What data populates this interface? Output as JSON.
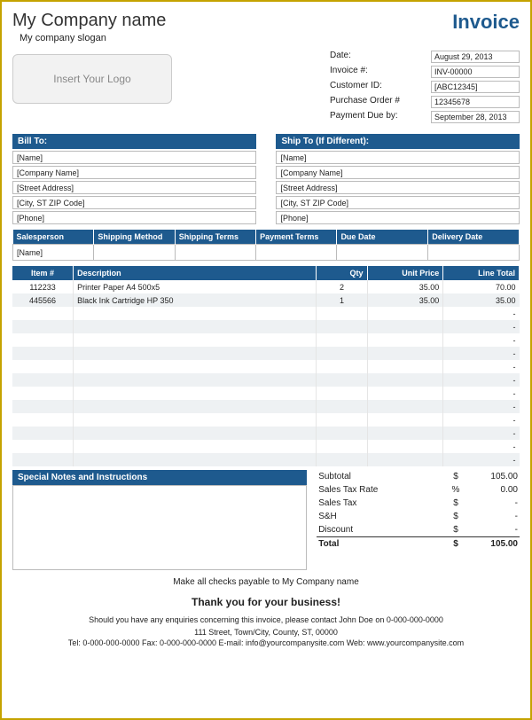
{
  "header": {
    "company_name": "My Company name",
    "slogan": "My company slogan",
    "invoice_title": "Invoice",
    "logo_placeholder": "Insert Your Logo"
  },
  "info": {
    "date_label": "Date:",
    "date_value": "August 29, 2013",
    "invoice_no_label": "Invoice #:",
    "invoice_no_value": "INV-00000",
    "customer_id_label": "Customer ID:",
    "customer_id_value": "[ABC12345]",
    "po_label": "Purchase Order #",
    "po_value": "12345678",
    "due_label": "Payment Due by:",
    "due_value": "September 28, 2013"
  },
  "bill_to": {
    "title": "Bill To:",
    "name": "[Name]",
    "company": "[Company Name]",
    "street": "[Street Address]",
    "city": "[City, ST  ZIP Code]",
    "phone": "[Phone]"
  },
  "ship_to": {
    "title": "Ship To (If Different):",
    "name": "[Name]",
    "company": "[Company Name]",
    "street": "[Street Address]",
    "city": "[City, ST  ZIP Code]",
    "phone": "[Phone]"
  },
  "terms": {
    "headers": [
      "Salesperson",
      "Shipping Method",
      "Shipping Terms",
      "Payment Terms",
      "Due Date",
      "Delivery Date"
    ],
    "values": [
      "[Name]",
      "",
      "",
      "",
      "",
      ""
    ]
  },
  "items": {
    "headers": {
      "item": "Item #",
      "desc": "Description",
      "qty": "Qty",
      "unit": "Unit Price",
      "line": "Line Total"
    },
    "rows": [
      {
        "item": "112233",
        "desc": "Printer Paper A4 500x5",
        "qty": "2",
        "unit": "35.00",
        "line": "70.00"
      },
      {
        "item": "445566",
        "desc": "Black Ink Cartridge HP 350",
        "qty": "1",
        "unit": "35.00",
        "line": "35.00"
      },
      {
        "item": "",
        "desc": "",
        "qty": "",
        "unit": "",
        "line": "-"
      },
      {
        "item": "",
        "desc": "",
        "qty": "",
        "unit": "",
        "line": "-"
      },
      {
        "item": "",
        "desc": "",
        "qty": "",
        "unit": "",
        "line": "-"
      },
      {
        "item": "",
        "desc": "",
        "qty": "",
        "unit": "",
        "line": "-"
      },
      {
        "item": "",
        "desc": "",
        "qty": "",
        "unit": "",
        "line": "-"
      },
      {
        "item": "",
        "desc": "",
        "qty": "",
        "unit": "",
        "line": "-"
      },
      {
        "item": "",
        "desc": "",
        "qty": "",
        "unit": "",
        "line": "-"
      },
      {
        "item": "",
        "desc": "",
        "qty": "",
        "unit": "",
        "line": "-"
      },
      {
        "item": "",
        "desc": "",
        "qty": "",
        "unit": "",
        "line": "-"
      },
      {
        "item": "",
        "desc": "",
        "qty": "",
        "unit": "",
        "line": "-"
      },
      {
        "item": "",
        "desc": "",
        "qty": "",
        "unit": "",
        "line": "-"
      },
      {
        "item": "",
        "desc": "",
        "qty": "",
        "unit": "",
        "line": "-"
      }
    ]
  },
  "notes": {
    "title": "Special Notes and Instructions"
  },
  "totals": {
    "subtotal_label": "Subtotal",
    "subtotal_sym": "$",
    "subtotal_val": "105.00",
    "tax_rate_label": "Sales Tax Rate",
    "tax_rate_sym": "%",
    "tax_rate_val": "0.00",
    "tax_label": "Sales Tax",
    "tax_sym": "$",
    "tax_val": "-",
    "sh_label": "S&H",
    "sh_sym": "$",
    "sh_val": "-",
    "discount_label": "Discount",
    "discount_sym": "$",
    "discount_val": "-",
    "total_label": "Total",
    "total_sym": "$",
    "total_val": "105.00"
  },
  "footer": {
    "payable": "Make all checks payable to My Company name",
    "thanks": "Thank you for your business!",
    "enquiry": "Should you have any enquiries concerning this invoice, please contact John Doe on 0-000-000-0000",
    "addr": "111 Street, Town/City, County, ST, 00000",
    "contact": "Tel: 0-000-000-0000 Fax: 0-000-000-0000 E-mail: info@yourcompanysite.com Web: www.yourcompanysite.com"
  }
}
